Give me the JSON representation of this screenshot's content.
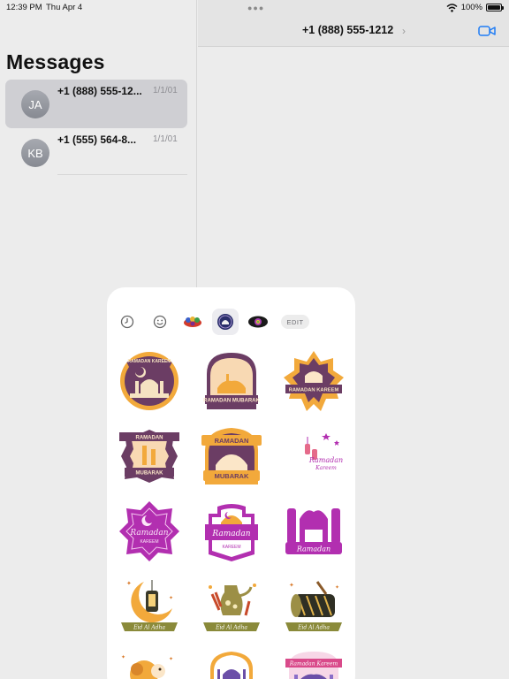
{
  "status_bar": {
    "time": "12:39 PM",
    "date": "Thu Apr 4",
    "battery": "100%"
  },
  "sidebar": {
    "title": "Messages",
    "conversations": [
      {
        "initials": "JA",
        "name": "+1 (888) 555-12...",
        "date": "1/1/01",
        "selected": true
      },
      {
        "initials": "KB",
        "name": "+1 (555) 564-8...",
        "date": "1/1/01",
        "selected": false
      }
    ]
  },
  "header": {
    "title": "+1 (888) 555-1212",
    "more_icon": "ellipsis-icon",
    "video_icon": "video-camera-icon"
  },
  "sticker_panel": {
    "tabs": [
      "recents-clock-icon",
      "emoji-smiley-icon",
      "sticker-pack-1-icon",
      "ramadan-pack-icon",
      "sticker-pack-3-icon"
    ],
    "edit_label": "EDIT",
    "stickers": [
      {
        "text": [
          "RAMADAN KAREEM"
        ]
      },
      {
        "text": [
          "RAMADAN MUBARAK"
        ]
      },
      {
        "text": [
          "RAMADAN KAREEM"
        ]
      },
      {
        "text": [
          "RAMADAN",
          "MUBARAK"
        ]
      },
      {
        "text": [
          "RAMADAN",
          "MUBARAK"
        ]
      },
      {
        "text": [
          "Ramadan",
          "Kareem"
        ]
      },
      {
        "text": [
          "Ramadan",
          "KAREEM"
        ]
      },
      {
        "text": [
          "Ramadan",
          "KAREEM"
        ]
      },
      {
        "text": [
          "Ramadan"
        ]
      },
      {
        "text": [
          "Eid Al Adha"
        ]
      },
      {
        "text": [
          "Eid Al Adha"
        ]
      },
      {
        "text": [
          "Eid Al Adha"
        ]
      },
      {
        "text": []
      },
      {
        "text": []
      },
      {
        "text": [
          "Ramadan Kareem"
        ]
      }
    ],
    "colors": {
      "purple": "#6b3d64",
      "orange": "#f2a93b",
      "magenta": "#b22fb0",
      "olive": "#8a8a3a",
      "cream": "#fbe6c8"
    }
  }
}
